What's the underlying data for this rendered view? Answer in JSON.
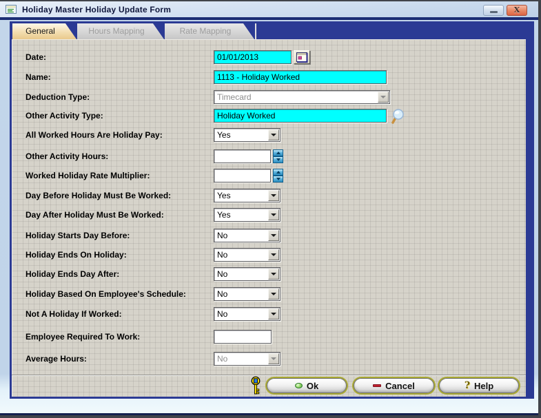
{
  "window": {
    "title": "Holiday Master Holiday Update Form",
    "minimize_glyph": "",
    "close_glyph": "X"
  },
  "tabs": [
    {
      "label": "General",
      "state": "active"
    },
    {
      "label": "Hours Mapping",
      "state": "disabled"
    },
    {
      "label": "Rate Mapping",
      "state": "disabled"
    }
  ],
  "form": {
    "fields": [
      {
        "label": "Date:",
        "value": "01/01/2013",
        "type": "date",
        "highlighted": true
      },
      {
        "label": "Name:",
        "value": "1113 - Holiday Worked",
        "type": "text",
        "highlighted": true
      },
      {
        "label": "Deduction Type:",
        "value": "Timecard",
        "type": "combo",
        "disabled": true
      },
      {
        "label": "Other Activity Type:",
        "value": "Holiday Worked",
        "type": "lookup",
        "highlighted": true
      },
      {
        "label": "All Worked Hours Are Holiday Pay:",
        "value": "Yes",
        "type": "combo"
      },
      {
        "label": "Other Activity Hours:",
        "value": "",
        "type": "spinner"
      },
      {
        "label": "Worked Holiday Rate Multiplier:",
        "value": "",
        "type": "spinner"
      },
      {
        "label": "Day Before Holiday Must Be Worked:",
        "value": "Yes",
        "type": "combo"
      },
      {
        "label": "Day After Holiday Must Be Worked:",
        "value": "Yes",
        "type": "combo"
      },
      {
        "label": "Holiday Starts Day Before:",
        "value": "No",
        "type": "combo"
      },
      {
        "label": "Holiday Ends On Holiday:",
        "value": "No",
        "type": "combo"
      },
      {
        "label": "Holiday Ends Day After:",
        "value": "No",
        "type": "combo"
      },
      {
        "label": "Holiday Based On Employee's Schedule:",
        "value": "No",
        "type": "combo"
      },
      {
        "label": "Not A Holiday If Worked:",
        "value": "No",
        "type": "combo"
      },
      {
        "label": "Employee Required To Work:",
        "value": "",
        "type": "text"
      },
      {
        "label": "Average Hours:",
        "value": "No",
        "type": "combo",
        "disabled": true
      }
    ]
  },
  "actions": {
    "ok": "Ok",
    "cancel": "Cancel",
    "help": "Help",
    "help_icon_glyph": "?"
  },
  "colors": {
    "highlight_field": "#00ffff",
    "tab_bar": "#2b3a94",
    "active_tab": "#f3ddb0",
    "panel": "#d6d3ca",
    "titlebar": "#d3e1f2",
    "close_button": "#dd6443"
  }
}
